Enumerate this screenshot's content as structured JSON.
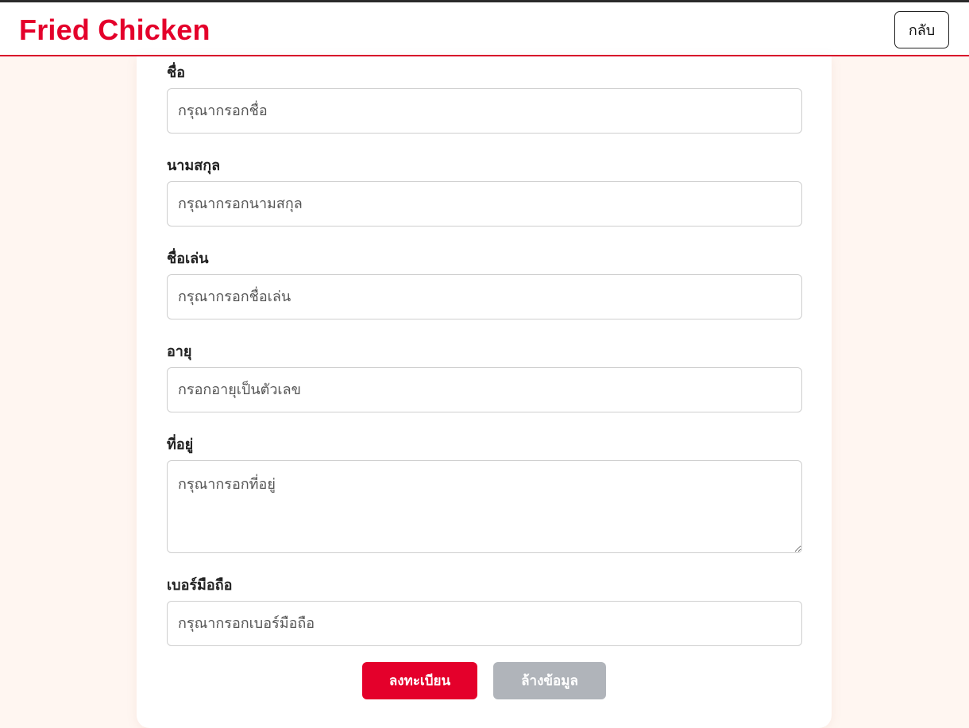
{
  "header": {
    "brand": "Fried Chicken",
    "back_label": "กลับ"
  },
  "form": {
    "fields": [
      {
        "label": "ชื่อ",
        "placeholder": "กรุณากรอกชื่อ",
        "value": ""
      },
      {
        "label": "นามสกุล",
        "placeholder": "กรุณากรอกนามสกุล",
        "value": ""
      },
      {
        "label": "ชื่อเล่น",
        "placeholder": "กรุณากรอกชื่อเล่น",
        "value": ""
      },
      {
        "label": "อายุ",
        "placeholder": "กรอกอายุเป็นตัวเลข",
        "value": ""
      },
      {
        "label": "ที่อยู่",
        "placeholder": "กรุณากรอกที่อยู่",
        "value": ""
      },
      {
        "label": "เบอร์มือถือ",
        "placeholder": "กรุณากรอกเบอร์มือถือ",
        "value": ""
      }
    ],
    "submit_label": "ลงทะเบียน",
    "clear_label": "ล้างข้อมูล"
  },
  "colors": {
    "brand": "#e4002b",
    "background": "#fff6f1",
    "secondary_button": "#b0b4ba"
  }
}
